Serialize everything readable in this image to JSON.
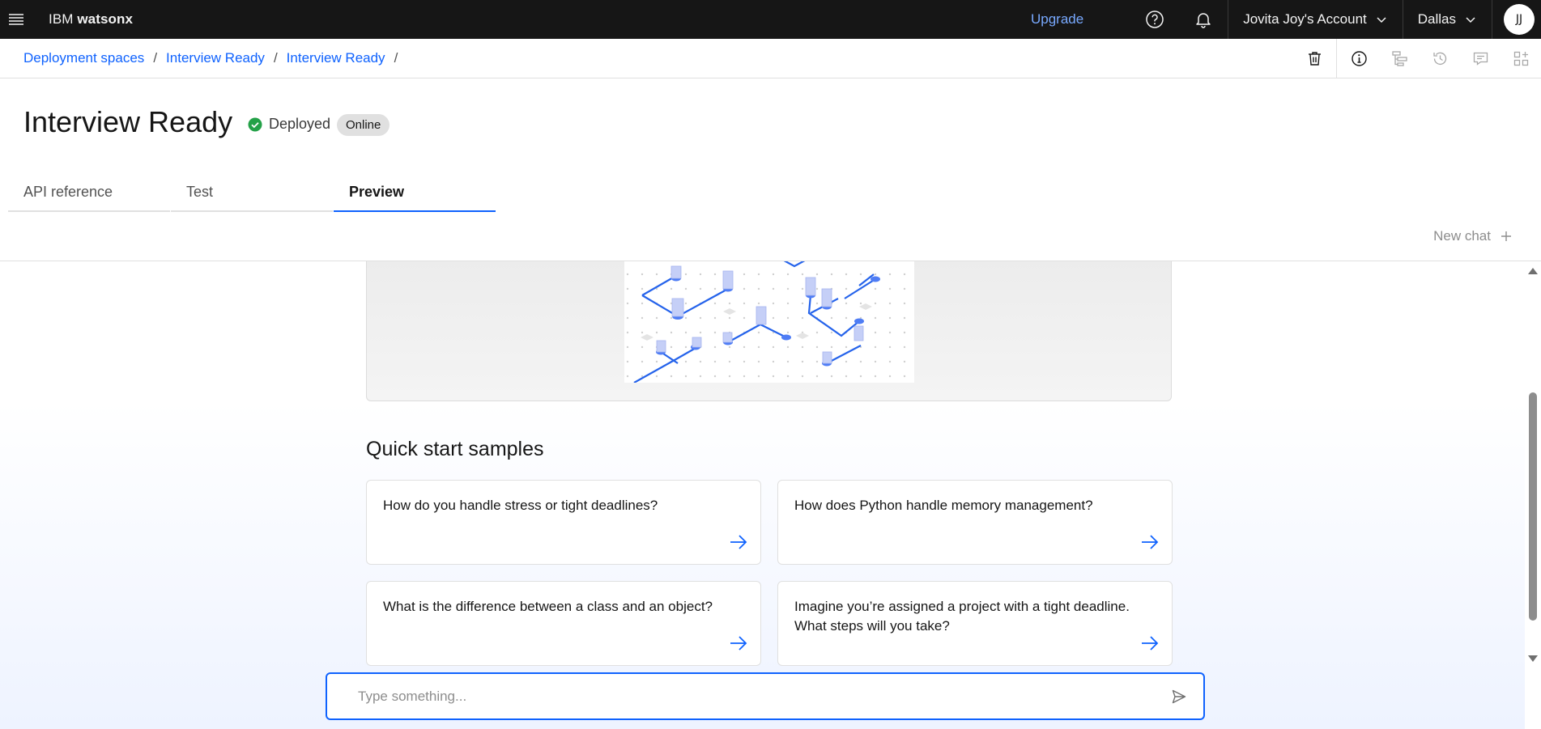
{
  "topbar": {
    "brand_prefix": "IBM",
    "brand_name": "watsonx",
    "upgrade": "Upgrade",
    "account": "Jovita Joy's Account",
    "region": "Dallas",
    "avatar_initials": "JJ"
  },
  "breadcrumb": {
    "items": [
      "Deployment spaces",
      "Interview Ready",
      "Interview Ready"
    ],
    "separator": "/"
  },
  "header": {
    "title": "Interview Ready",
    "status": "Deployed",
    "tag": "Online"
  },
  "tabs": [
    {
      "label": "API reference",
      "active": false
    },
    {
      "label": "Test",
      "active": false
    },
    {
      "label": "Preview",
      "active": true
    }
  ],
  "new_chat": "New chat",
  "quick_start": {
    "title": "Quick start samples",
    "samples": [
      "How do you handle stress or tight deadlines?",
      "How does Python handle memory management?",
      "What is the difference between a class and an object?",
      "Imagine you’re assigned a project with a tight deadline. What steps will you take?"
    ]
  },
  "chat_input": {
    "placeholder": "Type something...",
    "value": ""
  },
  "colors": {
    "accent": "#0f62fe",
    "topbar_bg": "#161616",
    "upgrade_link": "#78a9ff",
    "success": "#24a148"
  },
  "icons": {
    "menu": "hamburger-menu-icon",
    "help": "help-icon",
    "notifications": "bell-icon",
    "delete": "trash-icon",
    "info": "info-icon",
    "send": "send-icon",
    "arrow": "arrow-right-icon"
  }
}
